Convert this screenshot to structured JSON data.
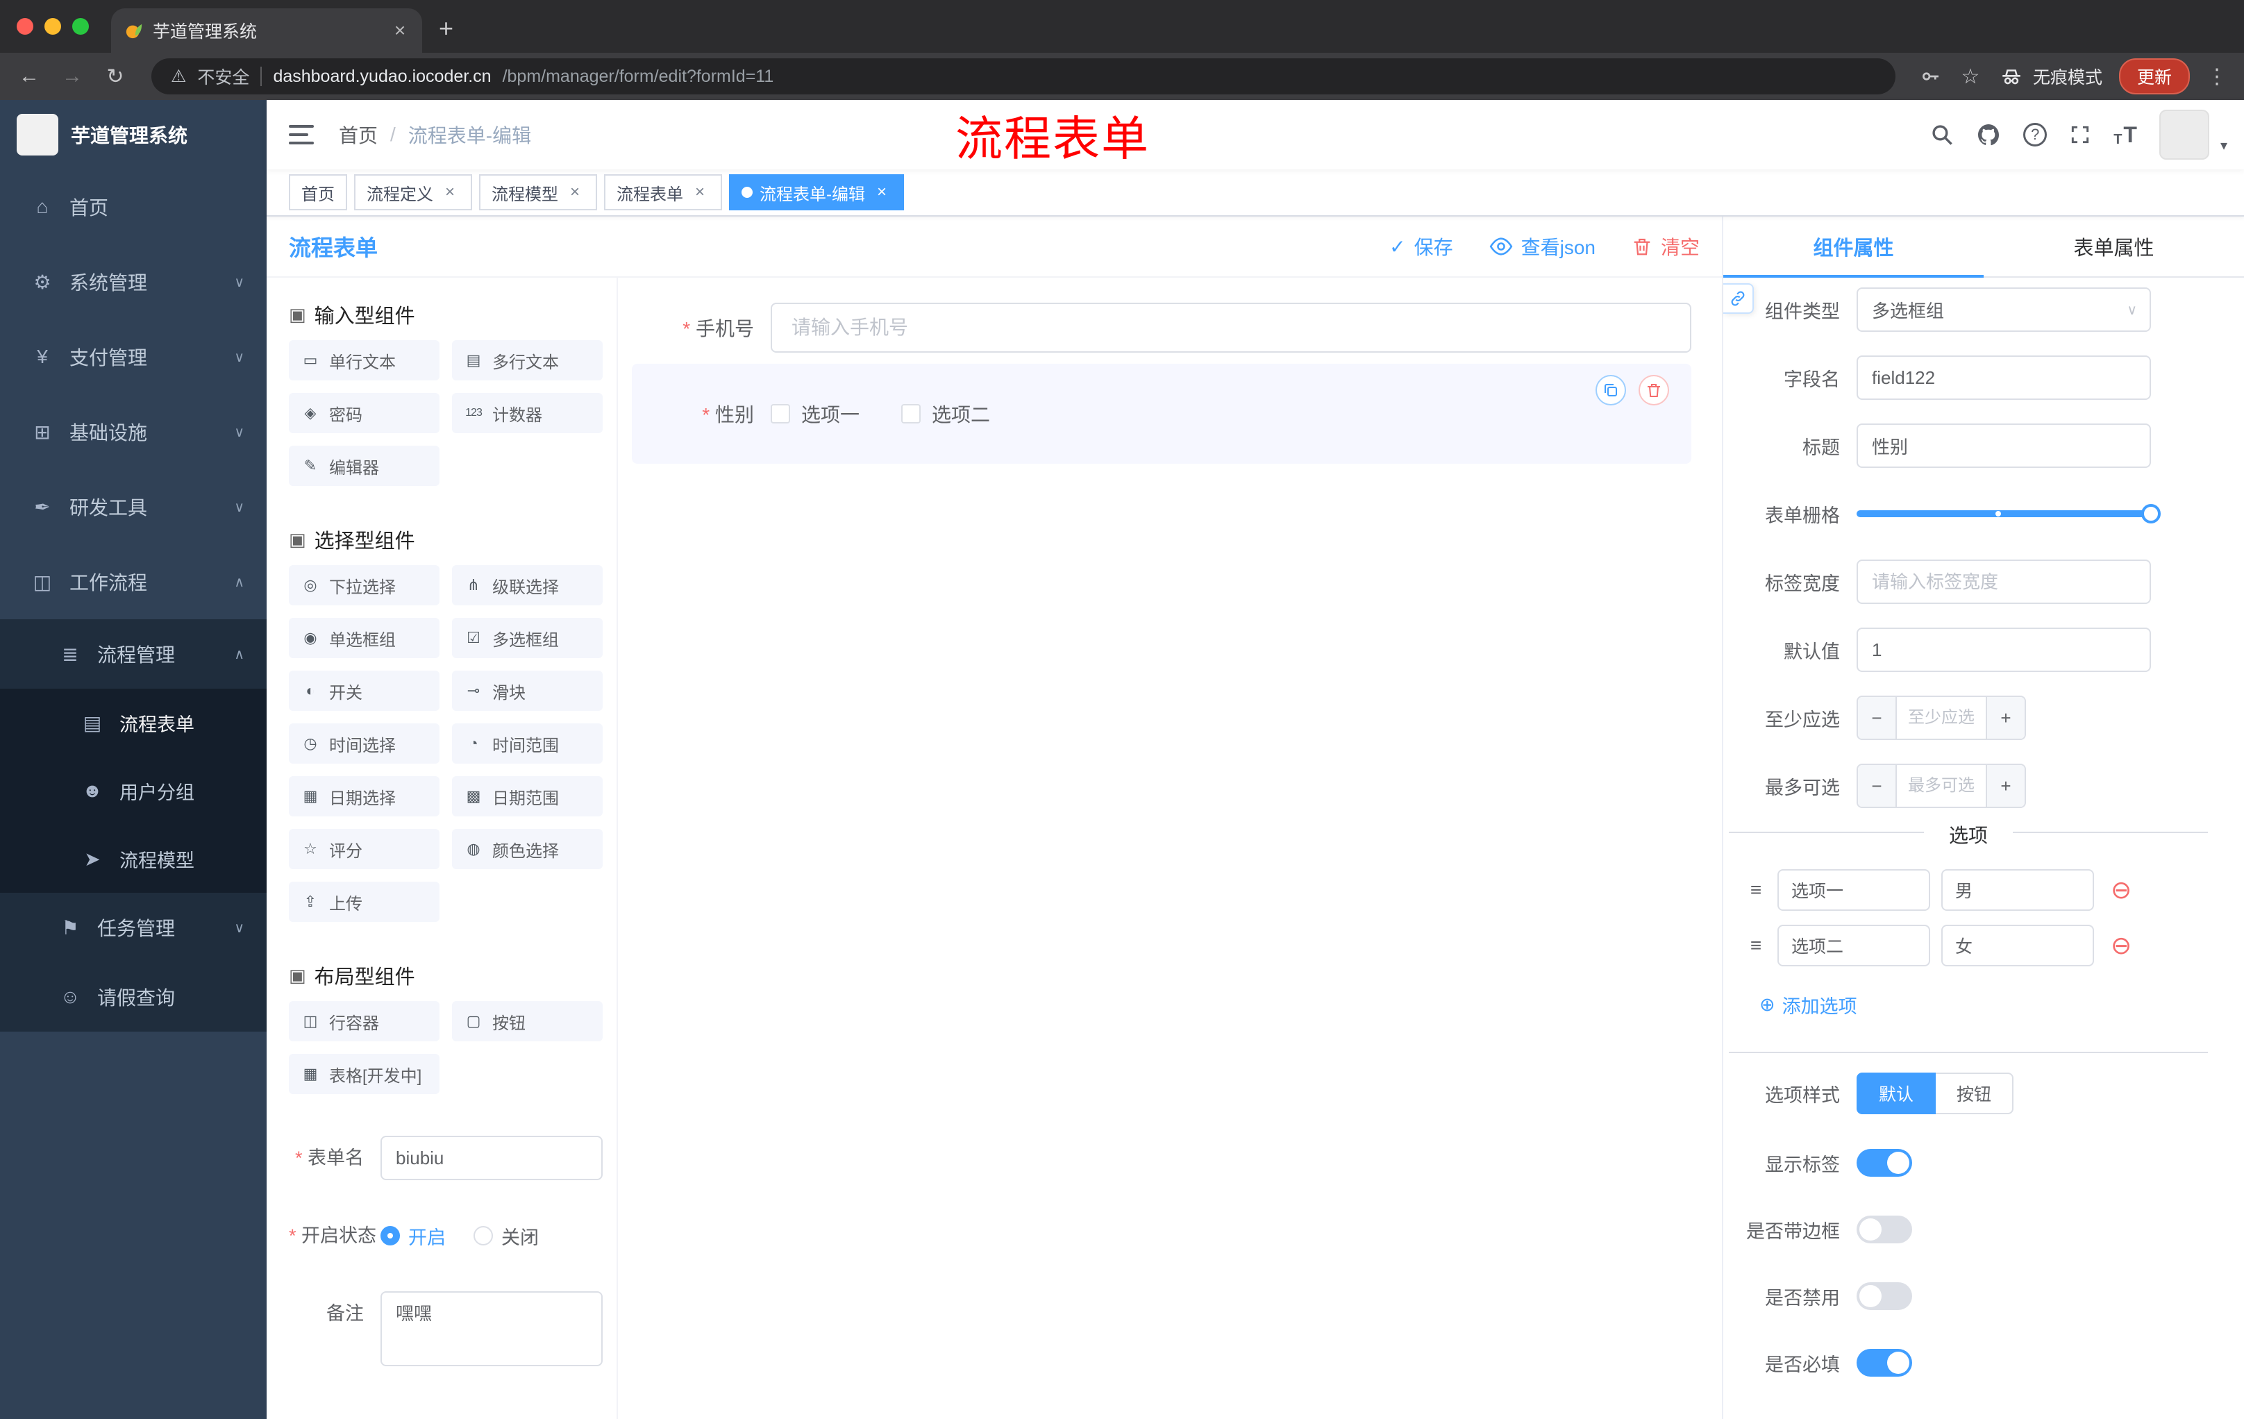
{
  "colors": {
    "accent": "#409eff",
    "danger": "#f56c6c",
    "annotation": "#ff0000",
    "sidebar_bg": "#304156",
    "sidebar_sub_bg": "#1f2d3d"
  },
  "glyphs": {
    "back": "←",
    "forward": "→",
    "reload": "↻",
    "new_tab": "+",
    "close": "×",
    "kebab": "⋮",
    "warning": "⚠",
    "star": "☆",
    "caret_down": "∨",
    "caret_up": "∧",
    "caret_small": "▾",
    "check": "✓",
    "drag": "≡",
    "remove_circle": "⊖",
    "add_circle": "⊕",
    "question": "?",
    "size_t": "T"
  },
  "browser": {
    "tab_title": "芋道管理系统",
    "security_label": "不安全",
    "url_host": "dashboard.yudao.iocoder.cn",
    "url_path": "/bpm/manager/form/edit?formId=11",
    "incognito_label": "无痕模式",
    "update_label": "更新"
  },
  "sidebar": {
    "logo_text": "芋道管理系统",
    "menu": [
      {
        "glyph": "⌂",
        "label": "首页",
        "arrow": ""
      },
      {
        "glyph": "⚙",
        "label": "系统管理",
        "arrow": "∨"
      },
      {
        "glyph": "¥",
        "label": "支付管理",
        "arrow": "∨"
      },
      {
        "glyph": "⊞",
        "label": "基础设施",
        "arrow": "∨"
      },
      {
        "glyph": "✒",
        "label": "研发工具",
        "arrow": "∨"
      },
      {
        "glyph": "◫",
        "label": "工作流程",
        "arrow": "∧"
      }
    ],
    "process_mgmt": {
      "glyph": "≣",
      "label": "流程管理",
      "arrow": "∧"
    },
    "leaves": [
      {
        "glyph": "▤",
        "label": "流程表单",
        "active": true
      },
      {
        "glyph": "☻",
        "label": "用户分组",
        "active": false
      },
      {
        "glyph": "➤",
        "label": "流程模型",
        "active": false
      }
    ],
    "task_mgmt": {
      "glyph": "⚑",
      "label": "任务管理",
      "arrow": "∨"
    },
    "leave_query": {
      "glyph": "☺",
      "label": "请假查询"
    }
  },
  "header": {
    "breadcrumb_home": "首页",
    "breadcrumb_sep": "/",
    "breadcrumb_current": "流程表单-编辑",
    "annotation": "流程表单"
  },
  "tags": [
    {
      "label": "首页",
      "closable": false,
      "active": false
    },
    {
      "label": "流程定义",
      "closable": true,
      "active": false
    },
    {
      "label": "流程模型",
      "closable": true,
      "active": false
    },
    {
      "label": "流程表单",
      "closable": true,
      "active": false
    },
    {
      "label": "流程表单-编辑",
      "closable": true,
      "active": true
    }
  ],
  "designer": {
    "title": "流程表单",
    "save": "保存",
    "view_json": "查看json",
    "clear": "清空"
  },
  "palette": {
    "sections": [
      {
        "title": "输入型组件",
        "icon": "▣",
        "items": [
          {
            "glyph": "▭",
            "label": "单行文本"
          },
          {
            "glyph": "▤",
            "label": "多行文本"
          },
          {
            "glyph": "◈",
            "label": "密码"
          },
          {
            "glyph": "123",
            "label": "计数器"
          },
          {
            "glyph": "✎",
            "label": "编辑器"
          }
        ]
      },
      {
        "title": "选择型组件",
        "icon": "▣",
        "items": [
          {
            "glyph": "◎",
            "label": "下拉选择"
          },
          {
            "glyph": "⋔",
            "label": "级联选择"
          },
          {
            "glyph": "◉",
            "label": "单选框组"
          },
          {
            "glyph": "☑",
            "label": "多选框组"
          },
          {
            "glyph": "◐",
            "label": "开关"
          },
          {
            "glyph": "⊸",
            "label": "滑块"
          },
          {
            "glyph": "◷",
            "label": "时间选择"
          },
          {
            "glyph": "◔",
            "label": "时间范围"
          },
          {
            "glyph": "▦",
            "label": "日期选择"
          },
          {
            "glyph": "▩",
            "label": "日期范围"
          },
          {
            "glyph": "☆",
            "label": "评分"
          },
          {
            "glyph": "◍",
            "label": "颜色选择"
          },
          {
            "glyph": "⇪",
            "label": "上传"
          }
        ]
      },
      {
        "title": "布局型组件",
        "icon": "▣",
        "items": [
          {
            "glyph": "◫",
            "label": "行容器"
          },
          {
            "glyph": "▢",
            "label": "按钮"
          },
          {
            "glyph": "▦",
            "label": "表格[开发中]"
          }
        ]
      }
    ]
  },
  "form_meta": {
    "name_label": "表单名",
    "name_value": "biubiu",
    "status_label": "开启状态",
    "status_on": "开启",
    "status_off": "关闭",
    "remark_label": "备注",
    "remark_value": "嘿嘿"
  },
  "canvas": {
    "phone_label": "手机号",
    "phone_placeholder": "请输入手机号",
    "gender_label": "性别",
    "gender_option1": "选项一",
    "gender_option2": "选项二"
  },
  "props": {
    "tab_component": "组件属性",
    "tab_form": "表单属性",
    "rows": {
      "component_type": {
        "label": "组件类型",
        "value": "多选框组"
      },
      "field_name": {
        "label": "字段名",
        "value": "field122"
      },
      "title": {
        "label": "标题",
        "value": "性别"
      },
      "grid": {
        "label": "表单栅格"
      },
      "label_width": {
        "label": "标签宽度",
        "placeholder": "请输入标签宽度"
      },
      "default_value": {
        "label": "默认值",
        "value": "1"
      },
      "min_select": {
        "label": "至少应选",
        "placeholder": "至少应选"
      },
      "max_select": {
        "label": "最多可选",
        "placeholder": "最多可选"
      }
    },
    "options_title": "选项",
    "options": [
      {
        "label": "选项一",
        "value": "男"
      },
      {
        "label": "选项二",
        "value": "女"
      }
    ],
    "add_option": "添加选项",
    "style": {
      "label": "选项样式",
      "default": "默认",
      "button": "按钮"
    },
    "toggles": [
      {
        "label": "显示标签",
        "on": true
      },
      {
        "label": "是否带边框",
        "on": false
      },
      {
        "label": "是否禁用",
        "on": false
      },
      {
        "label": "是否必填",
        "on": true
      }
    ]
  }
}
